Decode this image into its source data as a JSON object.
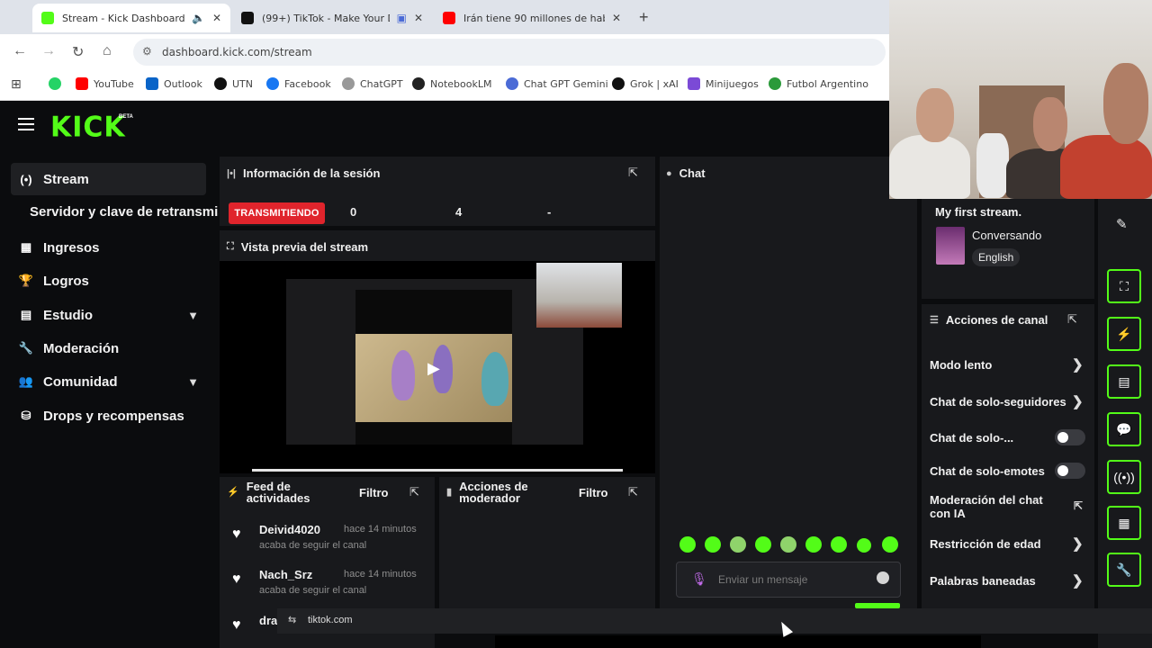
{
  "browser": {
    "tabs": [
      {
        "title": "Stream - Kick Dashboard",
        "favicon_color": "#53fc18",
        "active": true,
        "audio": true
      },
      {
        "title": "(99+) TikTok - Make Your D",
        "favicon_color": "#111111",
        "active": false,
        "audio": false
      },
      {
        "title": "Irán tiene 90 millones de habi",
        "favicon_color": "#ff0000",
        "active": false,
        "audio": false
      }
    ],
    "new_tab_label": "+",
    "url": "dashboard.kick.com/stream",
    "bookmarks": [
      {
        "label": "",
        "color": "#25d366"
      },
      {
        "label": "YouTube",
        "color": "#ff0000"
      },
      {
        "label": "Outlook",
        "color": "#0a64c8"
      },
      {
        "label": "UTN",
        "color": "#111111"
      },
      {
        "label": "Facebook",
        "color": "#1877f2"
      },
      {
        "label": "ChatGPT",
        "color": "#555555"
      },
      {
        "label": "NotebookLM",
        "color": "#222222"
      },
      {
        "label": "Chat GPT Gemini",
        "color": "#4b6bd6"
      },
      {
        "label": "Grok | xAI",
        "color": "#111111"
      },
      {
        "label": "Minijuegos",
        "color": "#7b4ad6"
      },
      {
        "label": "Futbol Argentino",
        "color": "#2b9a3a"
      }
    ]
  },
  "brand": {
    "logo": "KICK",
    "beta": "BETA",
    "accent": "#53fc18"
  },
  "sidebar": {
    "items": [
      {
        "label": "Stream",
        "icon": "broadcast-icon"
      },
      {
        "label": "Ingresos",
        "icon": "chart-icon"
      },
      {
        "label": "Logros",
        "icon": "trophy-icon"
      },
      {
        "label": "Estudio",
        "icon": "studio-icon"
      },
      {
        "label": "Moderación",
        "icon": "wrench-icon"
      },
      {
        "label": "Comunidad",
        "icon": "community-icon"
      },
      {
        "label": "Drops y recompensas",
        "icon": "gift-icon"
      }
    ],
    "sub_item": "Servidor y clave de retransmisión"
  },
  "session": {
    "title": "Información de la sesión",
    "status": "TRANSMITIENDO",
    "stats": [
      "0",
      "4",
      "-"
    ]
  },
  "preview": {
    "title": "Vista previa del stream"
  },
  "feed": {
    "title_line1": "Feed de",
    "title_line2": "actividades",
    "filter": "Filtro",
    "items": [
      {
        "user": "Deivid4020",
        "time": "hace 14 minutos",
        "action": "acaba de seguir el canal"
      },
      {
        "user": "Nach_Srz",
        "time": "hace 14 minutos",
        "action": "acaba de seguir el canal"
      },
      {
        "user": "dra",
        "time": "",
        "action": ""
      }
    ]
  },
  "mod_actions": {
    "title_line1": "Acciones de",
    "title_line2": "moderador",
    "filter": "Filtro"
  },
  "chat": {
    "title": "Chat",
    "placeholder": "Enviar un mensaje"
  },
  "stream_info": {
    "title": "My first stream.",
    "category": "Conversando",
    "language": "English"
  },
  "channel_actions": {
    "title": "Acciones de canal",
    "items": [
      {
        "label": "Modo lento",
        "control": "chevron"
      },
      {
        "label": "Chat de solo-seguidores",
        "control": "chevron"
      },
      {
        "label": "Chat de solo-...",
        "control": "toggle",
        "on": false
      },
      {
        "label": "Chat de solo-emotes",
        "control": "toggle",
        "on": false
      },
      {
        "label": "Moderación del chat con IA",
        "control": "popout"
      },
      {
        "label": "Restricción de edad",
        "control": "chevron"
      },
      {
        "label": "Palabras baneadas",
        "control": "chevron"
      }
    ]
  },
  "tooltip": {
    "url": "tiktok.com"
  }
}
